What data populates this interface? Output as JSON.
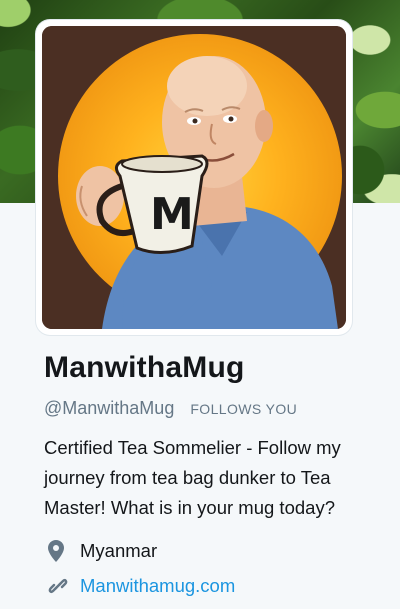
{
  "profile": {
    "display_name": "ManwithaMug",
    "handle": "@ManwithaMug",
    "follows_badge": "FOLLOWS YOU",
    "bio": "Certified Tea Sommelier - Follow my journey from tea bag dunker to Tea Master! What is in your mug today?",
    "location": "Myanmar",
    "website": "Manwithamug.com",
    "avatar_mug_letter": "M"
  },
  "icons": {
    "location": "location-pin-icon",
    "website": "link-icon"
  },
  "colors": {
    "link": "#1b95e0",
    "secondary_text": "#657786",
    "primary_text": "#14171a",
    "page_background": "#f5f8fa"
  }
}
